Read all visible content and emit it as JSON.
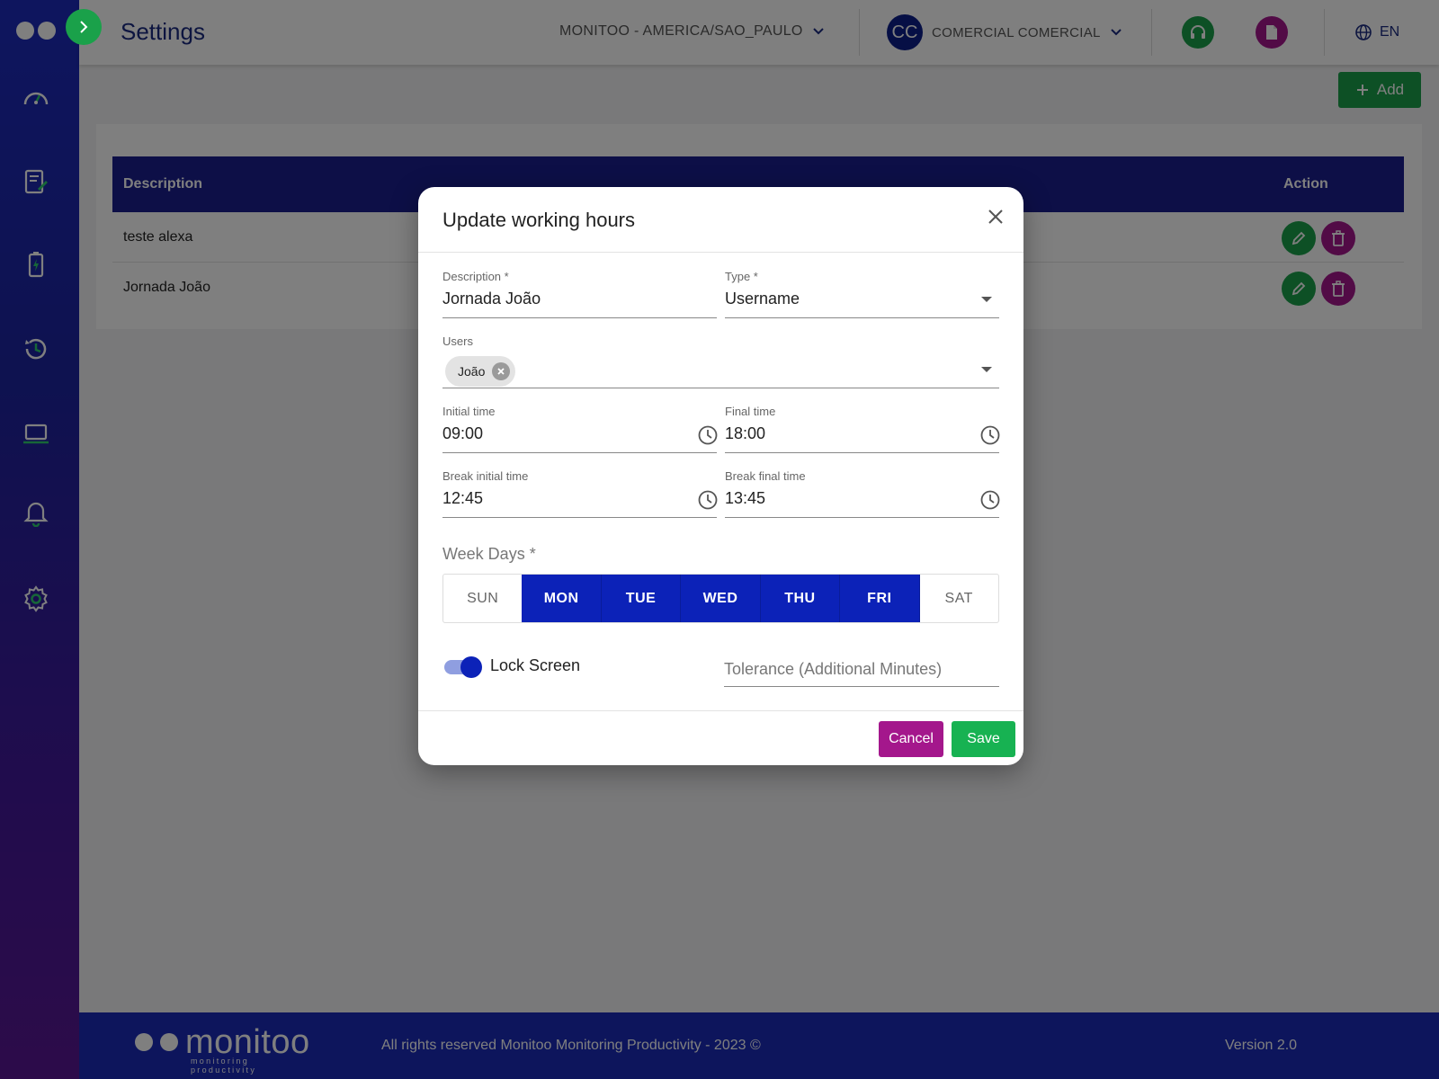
{
  "app": {
    "page_title": "Settings"
  },
  "topbar": {
    "timezone": "MONITOO - AMERICA/SAO_PAULO",
    "user_initials": "CC",
    "user_name": "COMERCIAL COMERCIAL",
    "language": "EN"
  },
  "sidebar": {
    "items": [
      {
        "icon": "dashboard-icon"
      },
      {
        "icon": "reports-icon"
      },
      {
        "icon": "battery-icon"
      },
      {
        "icon": "history-icon"
      },
      {
        "icon": "laptop-icon"
      },
      {
        "icon": "bell-icon"
      },
      {
        "icon": "gear-icon"
      }
    ]
  },
  "toolbar": {
    "add_label": "Add"
  },
  "table": {
    "headers": {
      "description": "Description",
      "action": "Action"
    },
    "rows": [
      {
        "description": "teste alexa"
      },
      {
        "description": "Jornada João"
      }
    ]
  },
  "modal": {
    "title": "Update working hours",
    "description": {
      "label": "Description *",
      "value": "Jornada João"
    },
    "type": {
      "label": "Type *",
      "value": "Username"
    },
    "users": {
      "label": "Users",
      "chips": [
        "João"
      ]
    },
    "initial_time": {
      "label": "Initial time",
      "value": "09:00"
    },
    "final_time": {
      "label": "Final time",
      "value": "18:00"
    },
    "break_initial_time": {
      "label": "Break initial time",
      "value": "12:45"
    },
    "break_final_time": {
      "label": "Break final time",
      "value": "13:45"
    },
    "week_days": {
      "label": "Week Days *",
      "days": [
        {
          "label": "SUN",
          "selected": false
        },
        {
          "label": "MON",
          "selected": true
        },
        {
          "label": "TUE",
          "selected": true
        },
        {
          "label": "WED",
          "selected": true
        },
        {
          "label": "THU",
          "selected": true
        },
        {
          "label": "FRI",
          "selected": true
        },
        {
          "label": "SAT",
          "selected": false
        }
      ]
    },
    "lock_screen": {
      "label": "Lock Screen",
      "enabled": true
    },
    "tolerance": {
      "placeholder": "Tolerance (Additional Minutes)"
    },
    "cancel_label": "Cancel",
    "save_label": "Save"
  },
  "footer": {
    "brand": "monitoo",
    "tagline": "monitoring productivity",
    "rights": "All rights reserved Monitoo Monitoring Productivity - 2023 ©",
    "version": "Version 2.0"
  },
  "colors": {
    "primary_blue": "#0c22b8",
    "green": "#1aa14a",
    "magenta": "#a4178c",
    "header_navy": "#1a1f8f"
  }
}
